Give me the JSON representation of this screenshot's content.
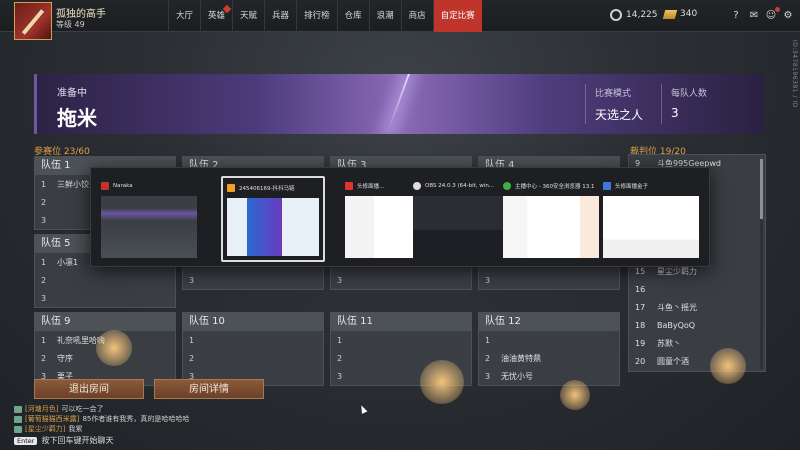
{
  "player": {
    "name": "孤独的高手",
    "level": "等级 49"
  },
  "nav": [
    "大厅",
    "英雄",
    "天赋",
    "兵器",
    "排行榜",
    "仓库",
    "浪潮",
    "商店",
    "自定比赛"
  ],
  "currency": {
    "coins": "14,225",
    "gold": "340"
  },
  "side_id": "ID:3478196391 / ID",
  "banner": {
    "status": "准备中",
    "room_name": "拖米",
    "mode_label": "比赛模式",
    "mode_value": "天选之人",
    "per_team_label": "每队人数",
    "per_team_value": "3"
  },
  "participants_label": "参赛位 23/60",
  "judges_label": "裁判位 19/20",
  "teams": [
    {
      "title": "队伍 1",
      "slots": [
        {
          "n": "1",
          "name": "三鲜小饺子"
        },
        {
          "n": "2",
          "name": ""
        },
        {
          "n": "3",
          "name": ""
        }
      ]
    },
    {
      "title": "队伍 2",
      "slots": []
    },
    {
      "title": "队伍 3",
      "slots": []
    },
    {
      "title": "队伍 4",
      "slots": []
    },
    {
      "title": "队伍 5",
      "slots": [
        {
          "n": "1",
          "name": "小凛1"
        },
        {
          "n": "2",
          "name": ""
        },
        {
          "n": "3",
          "name": ""
        }
      ]
    },
    {
      "title": "",
      "slots": [
        {
          "n": "2",
          "name": ""
        },
        {
          "n": "3",
          "name": ""
        }
      ]
    },
    {
      "title": "",
      "slots": [
        {
          "n": "2",
          "name": ""
        },
        {
          "n": "3",
          "name": ""
        }
      ]
    },
    {
      "title": "",
      "slots": [
        {
          "n": "2",
          "name": ""
        },
        {
          "n": "3",
          "name": ""
        }
      ]
    },
    {
      "title": "队伍 9",
      "slots": [
        {
          "n": "1",
          "name": "礼奈吼里哈嗨"
        },
        {
          "n": "2",
          "name": "守序"
        },
        {
          "n": "3",
          "name": "栗子"
        }
      ]
    },
    {
      "title": "队伍 10",
      "slots": [
        {
          "n": "1",
          "name": ""
        },
        {
          "n": "2",
          "name": ""
        },
        {
          "n": "3",
          "name": ""
        }
      ]
    },
    {
      "title": "队伍 11",
      "slots": [
        {
          "n": "1",
          "name": ""
        },
        {
          "n": "2",
          "name": ""
        },
        {
          "n": "3",
          "name": ""
        }
      ]
    },
    {
      "title": "队伍 12",
      "slots": [
        {
          "n": "1",
          "name": ""
        },
        {
          "n": "2",
          "name": "油油黄特鼎"
        },
        {
          "n": "3",
          "name": "无忧小号"
        }
      ]
    }
  ],
  "judges": [
    {
      "n": "9",
      "name": "斗鱼995Geepwd"
    },
    {
      "n": "15",
      "name": "星尘少羁力"
    },
    {
      "n": "16",
      "name": ""
    },
    {
      "n": "17",
      "name": "斗鱼丶摇光"
    },
    {
      "n": "18",
      "name": "BaByQoQ"
    },
    {
      "n": "19",
      "name": "苏默丶"
    },
    {
      "n": "20",
      "name": "圆童个酒"
    }
  ],
  "windows": [
    {
      "title": "Naraka"
    },
    {
      "title": "245406169-抖抖马链"
    },
    {
      "title": "头修面播..."
    },
    {
      "title": "OBS 24.0.3 (64-bit, win..."
    },
    {
      "title": "主播中心 - 360安全浏览器 13.1"
    },
    {
      "title": "头修面播金子"
    }
  ],
  "buttons": {
    "exit": "退出房间",
    "details": "房间详情"
  },
  "chat": [
    {
      "tag": "[河塘月色]",
      "text": "可以吃一会了"
    },
    {
      "tag": "[葡萄猫猫西米露]",
      "text": "85作者谁有我秀，真的是哈哈哈哈"
    },
    {
      "tag": "[星尘少羁力]",
      "text": "我累"
    }
  ],
  "chat_key": "Enter",
  "chat_hint": "按下回车键开始聊天",
  "colors": {
    "accent": "#c0352b",
    "section": "#e3a24a",
    "banner": "#5a4790"
  }
}
